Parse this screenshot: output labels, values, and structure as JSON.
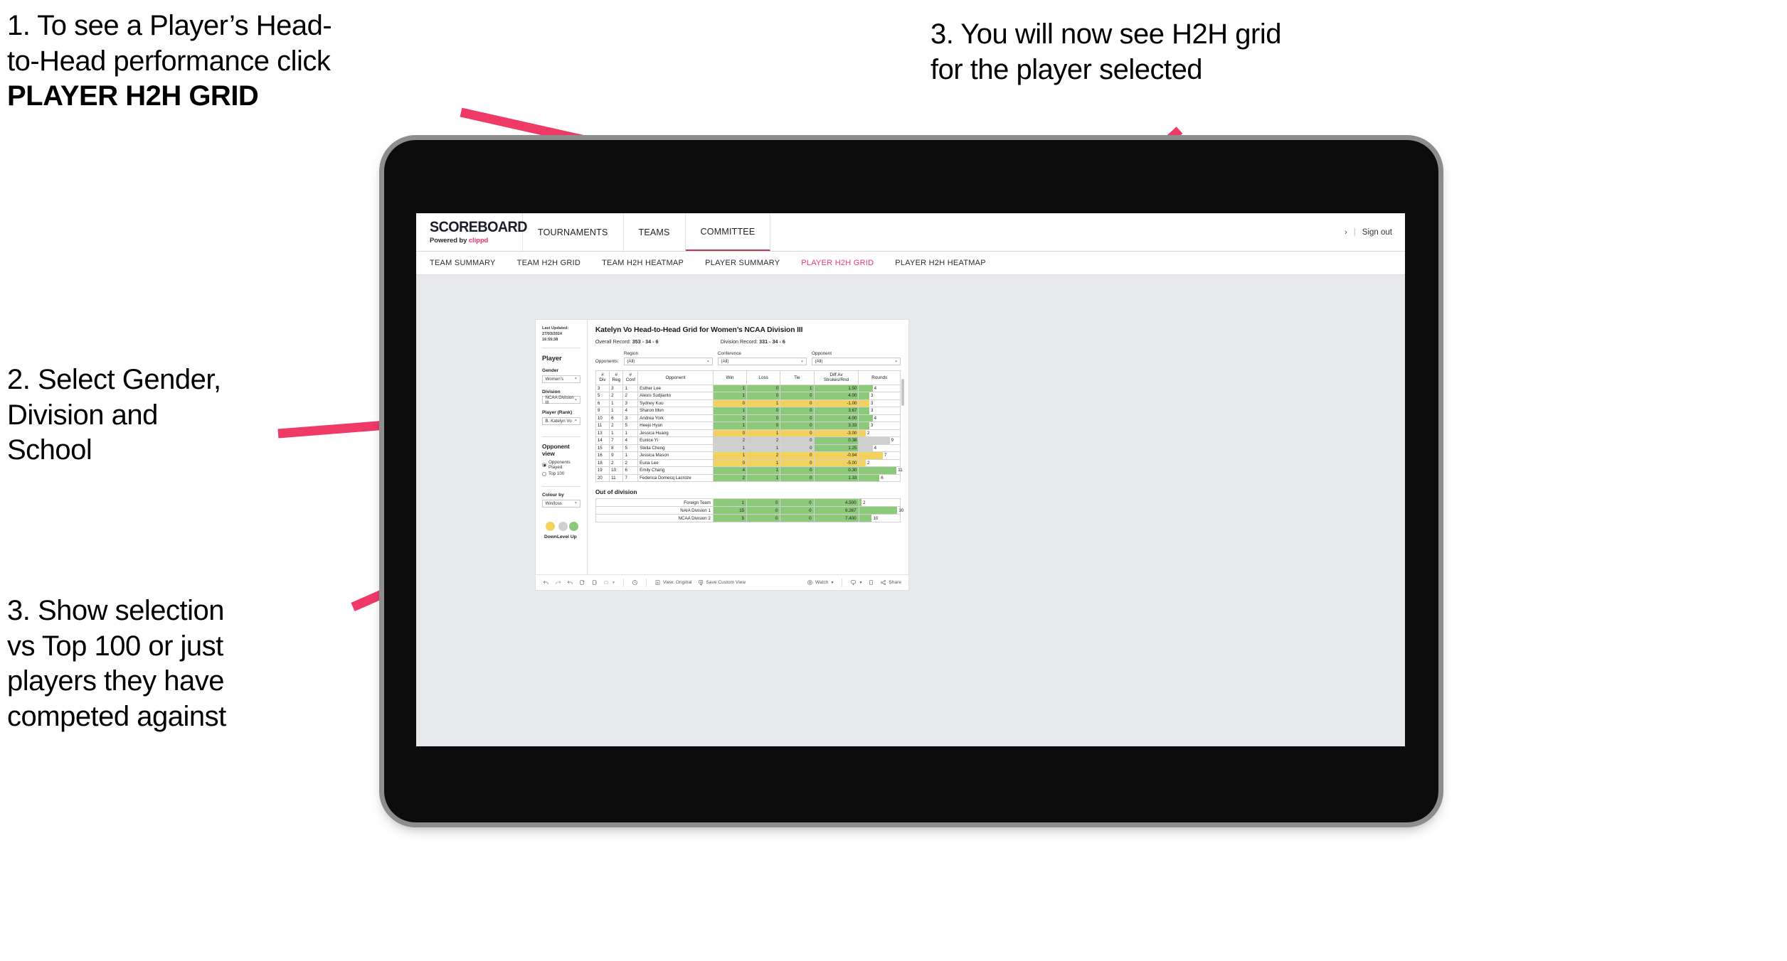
{
  "annotations": [
    {
      "id": "anno1",
      "lines": [
        "1. To see a Player’s Head-",
        "to-Head performance click"
      ],
      "bold_line": "PLAYER H2H GRID"
    },
    {
      "id": "anno2",
      "lines": [
        "2. Select Gender,",
        "Division and",
        "School"
      ],
      "bold_line": ""
    },
    {
      "id": "anno3",
      "lines": [
        "3. Show selection",
        "vs Top 100 or just",
        "players they have",
        "competed against"
      ],
      "bold_line": ""
    },
    {
      "id": "anno4",
      "lines": [
        "3. You will now see H2H grid",
        "for the player selected"
      ],
      "bold_line": ""
    }
  ],
  "annotation_text": {
    "a1_l1": "1. To see a Player’s Head-",
    "a1_l2": "to-Head performance click",
    "a1_l3": "PLAYER H2H GRID",
    "a2_l1": "2. Select Gender,",
    "a2_l2": "Division and",
    "a2_l3": "School",
    "a3_l1": "3. Show selection",
    "a3_l2": "vs Top 100 or just",
    "a3_l3": "players they have",
    "a3_l4": "competed against",
    "a4_l1": "3. You will now see H2H grid",
    "a4_l2": "for the player selected"
  },
  "colors": {
    "arrow_pink": "#ef3a68",
    "accent_pink": "#e8386b",
    "brand_red": "#ee3366",
    "up_green": "#8dc97a",
    "down_yellow": "#f2d25c",
    "level_grey": "#cfcfcf",
    "canvas_bg": "#e6e8eb"
  },
  "app": {
    "logo": {
      "main": "SCOREBOARD",
      "sub_prefix": "Powered by ",
      "sub_brand": "clippd"
    },
    "nav": [
      {
        "label": "TOURNAMENTS",
        "active": false
      },
      {
        "label": "TEAMS",
        "active": false
      },
      {
        "label": "COMMITTEE",
        "active": true
      }
    ],
    "header_right": {
      "chevron": "›",
      "separator": "|",
      "sign_out": "Sign out"
    },
    "subnav": [
      {
        "label": "TEAM SUMMARY",
        "active": false
      },
      {
        "label": "TEAM H2H GRID",
        "active": false
      },
      {
        "label": "TEAM H2H HEATMAP",
        "active": false
      },
      {
        "label": "PLAYER SUMMARY",
        "active": false
      },
      {
        "label": "PLAYER H2H GRID",
        "active": true
      },
      {
        "label": "PLAYER H2H HEATMAP",
        "active": false
      }
    ]
  },
  "sidebar": {
    "last_updated": "Last Updated: 27/03/2024",
    "last_updated_time": "16:55:38",
    "player_heading": "Player",
    "fields": [
      {
        "label": "Gender",
        "value": "Women’s"
      },
      {
        "label": "Division",
        "value": "NCAA Division III"
      },
      {
        "label": "Player (Rank)",
        "value": "B. Katelyn Vo"
      }
    ],
    "opponent_view": {
      "heading": "Opponent view",
      "options": [
        {
          "label": "Opponents Played",
          "selected": true
        },
        {
          "label": "Top 100",
          "selected": false
        }
      ]
    },
    "colour_by": {
      "label": "Colour by",
      "value": "Win/loss"
    },
    "legend": [
      {
        "caption": "Down",
        "color": "#f2d25c"
      },
      {
        "caption": "Level",
        "color": "#cfcfcf"
      },
      {
        "caption": "Up",
        "color": "#8dc97a"
      }
    ]
  },
  "main": {
    "title": "Katelyn Vo Head-to-Head Grid for Women’s NCAA Division III",
    "overall_record_label": "Overall Record: ",
    "overall_record_value": "353 - 34 - 6",
    "division_record_label": "Division Record: ",
    "division_record_value": "331 - 34 - 6",
    "opponents_label": "Opponents:",
    "filters": [
      {
        "label": "Region",
        "value": "(All)"
      },
      {
        "label": "Conference",
        "value": "(All)"
      },
      {
        "label": "Opponent",
        "value": "(All)"
      }
    ],
    "out_of_division_title": "Out of division"
  },
  "chart_data": {
    "type": "table",
    "title": "Katelyn Vo Head-to-Head Grid for Women’s NCAA Division III",
    "columns": [
      "# Div",
      "# Reg",
      "# Conf",
      "Opponent",
      "Win",
      "Loss",
      "Tie",
      "Diff Av Strokes/Rnd",
      "Rounds"
    ],
    "column_headers_two_line": [
      [
        "#",
        "Div"
      ],
      [
        "#",
        "Reg"
      ],
      [
        "#",
        "Conf"
      ],
      [
        "Opponent",
        ""
      ],
      [
        "Win",
        ""
      ],
      [
        "Loss",
        ""
      ],
      [
        "Tie",
        ""
      ],
      [
        "Diff Av",
        "Strokes/Rnd"
      ],
      [
        "Rounds",
        ""
      ]
    ],
    "rounds_max": 12,
    "rows": [
      {
        "div": "3",
        "reg": "3",
        "conf": "1",
        "opponent": "Esther Lee",
        "win": "1",
        "loss": "0",
        "tie": "1",
        "diff": "1.50",
        "rounds": "4",
        "color": "up"
      },
      {
        "div": "5",
        "reg": "2",
        "conf": "2",
        "opponent": "Alexis Sudjianto",
        "win": "1",
        "loss": "0",
        "tie": "0",
        "diff": "4.00",
        "rounds": "3",
        "color": "up"
      },
      {
        "div": "6",
        "reg": "1",
        "conf": "3",
        "opponent": "Sydney Kuo",
        "win": "0",
        "loss": "1",
        "tie": "0",
        "diff": "-1.00",
        "rounds": "3",
        "color": "down"
      },
      {
        "div": "9",
        "reg": "1",
        "conf": "4",
        "opponent": "Sharon Mun",
        "win": "1",
        "loss": "0",
        "tie": "0",
        "diff": "3.67",
        "rounds": "3",
        "color": "up"
      },
      {
        "div": "10",
        "reg": "6",
        "conf": "3",
        "opponent": "Andrea York",
        "win": "2",
        "loss": "0",
        "tie": "0",
        "diff": "4.00",
        "rounds": "4",
        "color": "up"
      },
      {
        "div": "11",
        "reg": "2",
        "conf": "5",
        "opponent": "Heejo Hyun",
        "win": "1",
        "loss": "0",
        "tie": "0",
        "diff": "3.33",
        "rounds": "3",
        "color": "up"
      },
      {
        "div": "13",
        "reg": "1",
        "conf": "1",
        "opponent": "Jessica Huang",
        "win": "0",
        "loss": "1",
        "tie": "0",
        "diff": "-3.00",
        "rounds": "2",
        "color": "down"
      },
      {
        "div": "14",
        "reg": "7",
        "conf": "4",
        "opponent": "Eunice Yi",
        "win": "2",
        "loss": "2",
        "tie": "0",
        "diff": "0.38",
        "rounds": "9",
        "color": "level",
        "diff_color": "up"
      },
      {
        "div": "15",
        "reg": "8",
        "conf": "5",
        "opponent": "Stella Cheng",
        "win": "1",
        "loss": "1",
        "tie": "0",
        "diff": "1.25",
        "rounds": "4",
        "color": "level",
        "diff_color": "up"
      },
      {
        "div": "16",
        "reg": "9",
        "conf": "1",
        "opponent": "Jessica Mason",
        "win": "1",
        "loss": "2",
        "tie": "0",
        "diff": "-0.94",
        "rounds": "7",
        "color": "down"
      },
      {
        "div": "18",
        "reg": "2",
        "conf": "2",
        "opponent": "Euna Lee",
        "win": "0",
        "loss": "1",
        "tie": "0",
        "diff": "-5.00",
        "rounds": "2",
        "color": "down"
      },
      {
        "div": "19",
        "reg": "10",
        "conf": "6",
        "opponent": "Emily Chang",
        "win": "4",
        "loss": "1",
        "tie": "0",
        "diff": "0.30",
        "rounds": "11",
        "color": "up"
      },
      {
        "div": "20",
        "reg": "11",
        "conf": "7",
        "opponent": "Federica Domecq Lacroze",
        "win": "2",
        "loss": "1",
        "tie": "0",
        "diff": "1.33",
        "rounds": "6",
        "color": "up"
      }
    ],
    "out_of_division": {
      "title": "Out of division",
      "rounds_max": 32,
      "rows": [
        {
          "name": "Foreign Team",
          "win": "1",
          "loss": "0",
          "tie": "0",
          "diff": "4.500",
          "rounds": "2",
          "color": "up"
        },
        {
          "name": "NAIA Division 1",
          "win": "15",
          "loss": "0",
          "tie": "0",
          "diff": "9.267",
          "rounds": "30",
          "color": "up"
        },
        {
          "name": "NCAA Division 2",
          "win": "5",
          "loss": "0",
          "tie": "0",
          "diff": "7.400",
          "rounds": "10",
          "color": "up"
        }
      ]
    }
  },
  "toolbar": {
    "items": [
      {
        "name": "undo-icon",
        "label": ""
      },
      {
        "name": "redo-icon",
        "label": ""
      },
      {
        "name": "revert-icon",
        "label": ""
      },
      {
        "name": "refresh-icon",
        "label": ""
      },
      {
        "name": "pause-icon",
        "label": ""
      },
      {
        "name": "layout-icon",
        "label": ""
      }
    ],
    "view_original": "View: Original",
    "save_custom_view": "Save Custom View",
    "watch": "Watch",
    "share": "Share"
  }
}
